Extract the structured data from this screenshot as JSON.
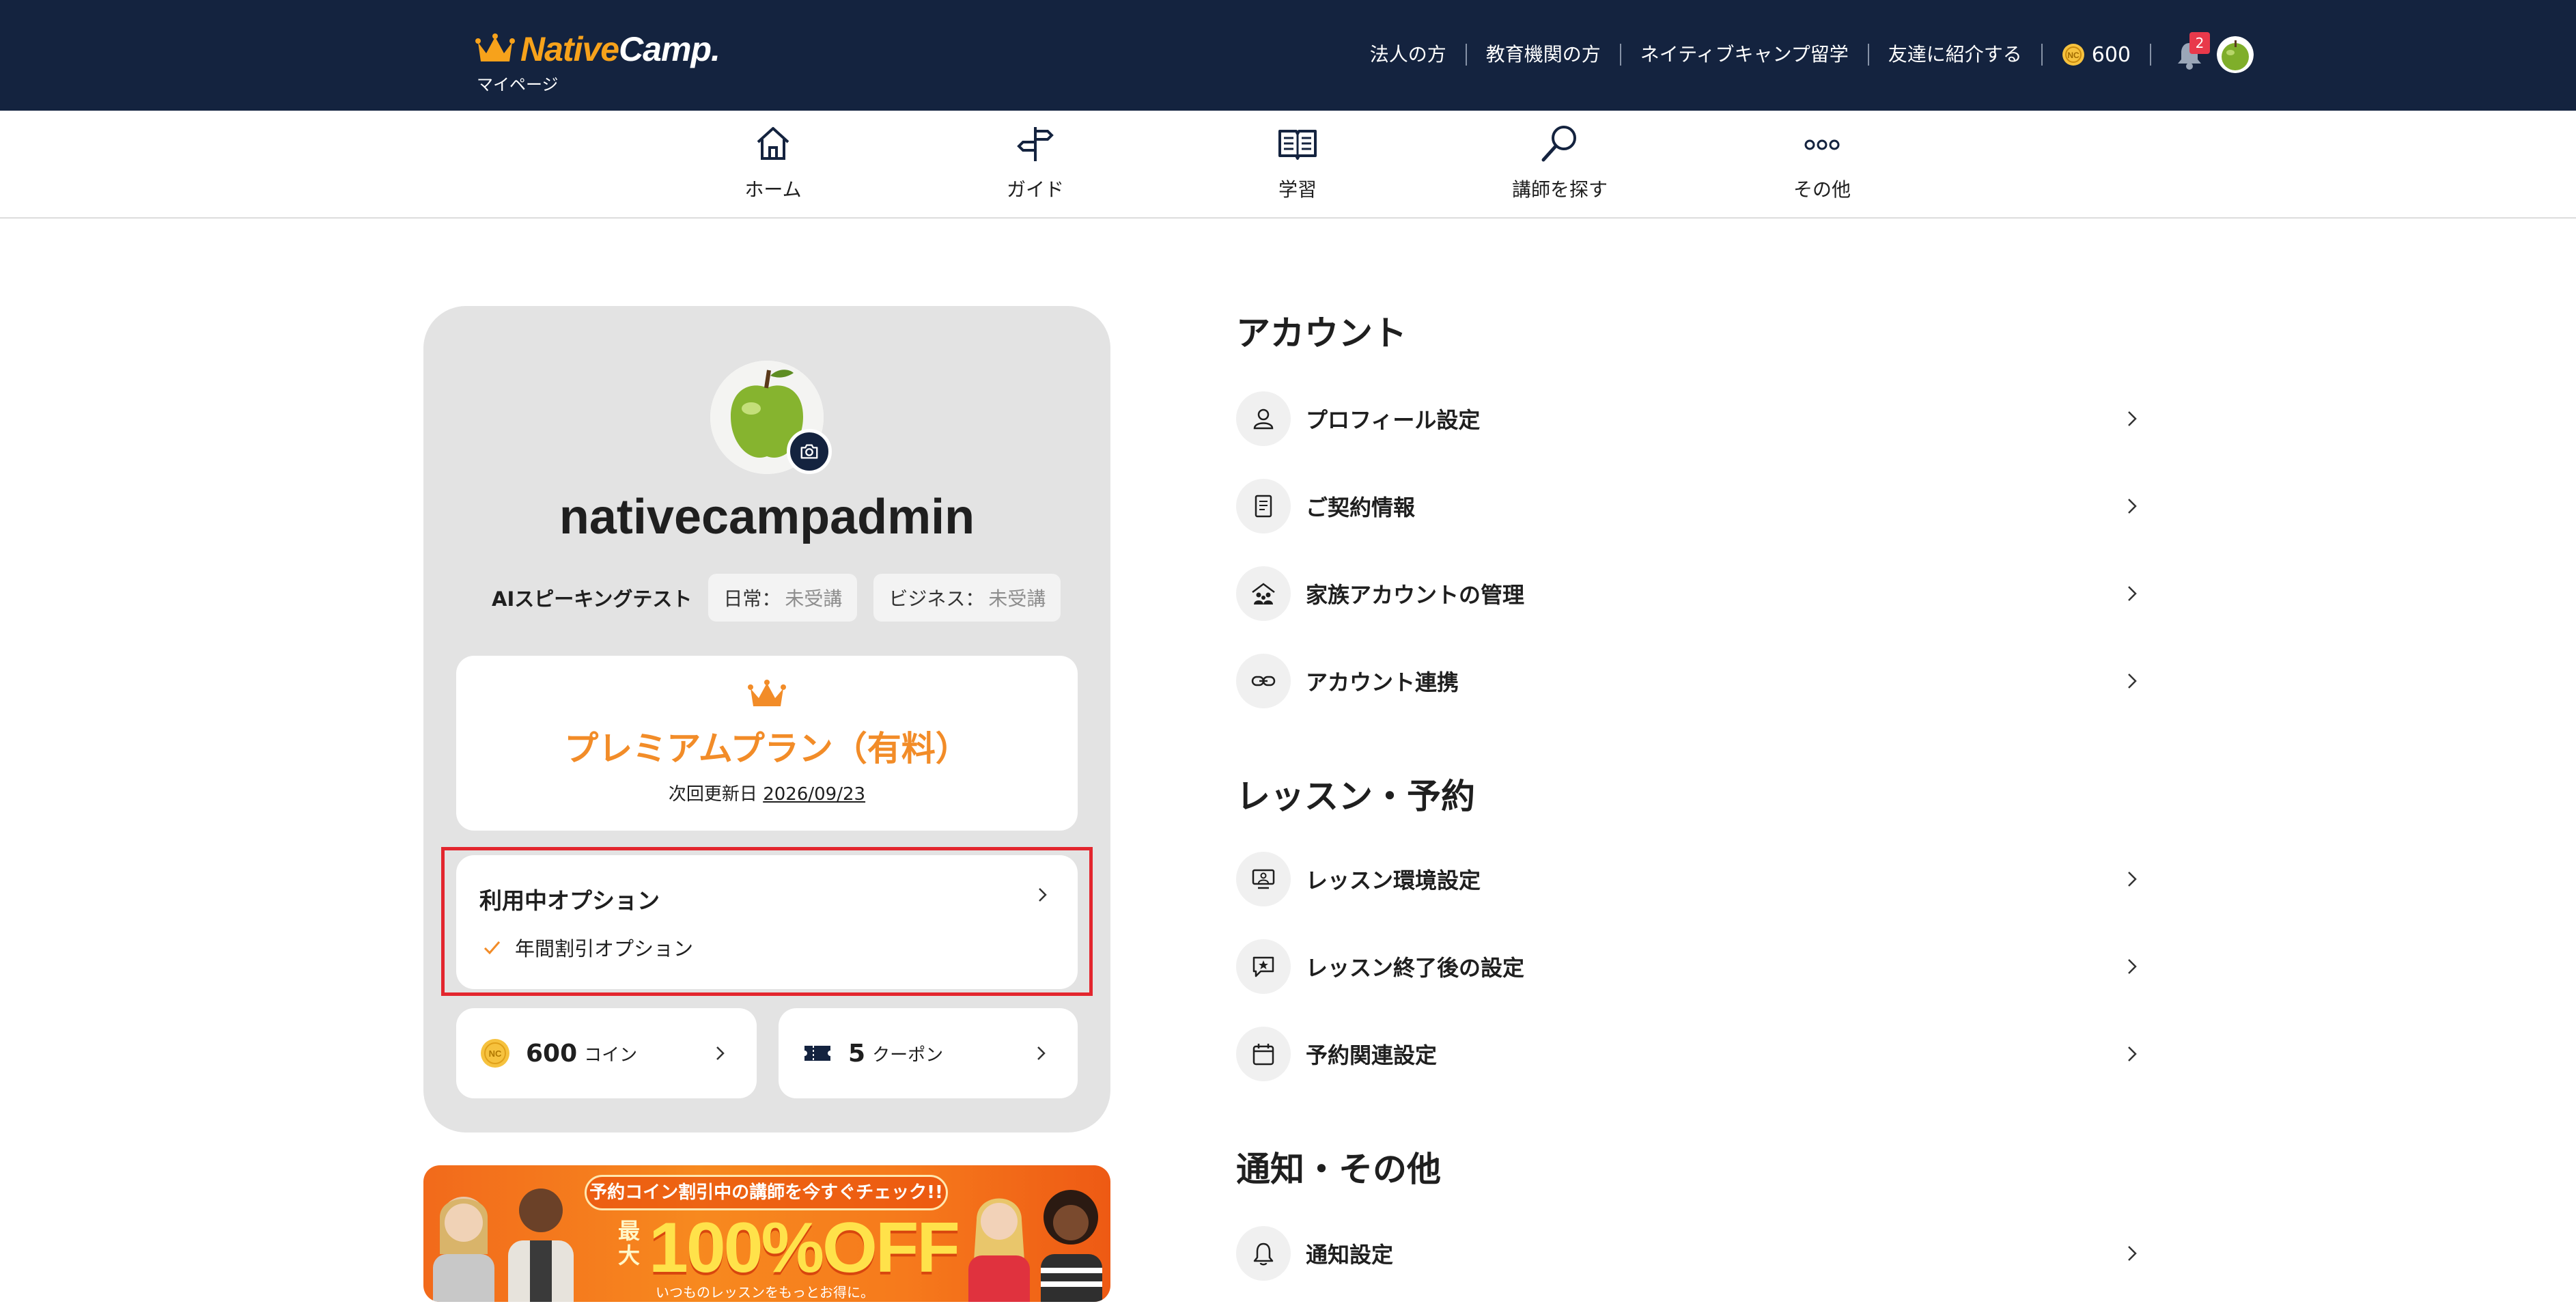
{
  "header": {
    "brand_native": "Native",
    "brand_camp": "Camp.",
    "subtitle": "マイページ",
    "links": [
      "法人の方",
      "教育機関の方",
      "ネイティブキャンプ留学",
      "友達に紹介する"
    ],
    "coins": "600",
    "notification_count": "2"
  },
  "nav": {
    "items": [
      {
        "label": "ホーム",
        "icon": "home-icon"
      },
      {
        "label": "ガイド",
        "icon": "signpost-icon"
      },
      {
        "label": "学習",
        "icon": "book-icon"
      },
      {
        "label": "講師を探す",
        "icon": "search-icon"
      },
      {
        "label": "その他",
        "icon": "more-icon"
      }
    ]
  },
  "profile": {
    "username": "nativecampadmin",
    "ai_test_label": "AIスピーキングテスト",
    "ai_daily_key": "日常：",
    "ai_daily_value": "未受講",
    "ai_business_key": "ビジネス：",
    "ai_business_value": "未受講",
    "plan_name": "プレミアムプラン（有料）",
    "renew_label": "次回更新日",
    "renew_date": "2026/09/23",
    "options_title": "利用中オプション",
    "option_item": "年間割引オプション",
    "coin_count": "600",
    "coin_unit": "コイン",
    "coupon_count": "5",
    "coupon_unit": "クーポン"
  },
  "banner": {
    "headline": "予約コイン割引中の講師を今すぐチェック!!",
    "max": "最大",
    "discount": "100%OFF",
    "sub": "いつものレッスンをもっとお得に。"
  },
  "settings": {
    "account_title": "アカウント",
    "account_items": [
      {
        "label": "プロフィール設定",
        "icon": "user-icon"
      },
      {
        "label": "ご契約情報",
        "icon": "document-icon"
      },
      {
        "label": "家族アカウントの管理",
        "icon": "family-icon"
      },
      {
        "label": "アカウント連携",
        "icon": "link-icon"
      }
    ],
    "lesson_title": "レッスン・予約",
    "lesson_items": [
      {
        "label": "レッスン環境設定",
        "icon": "monitor-icon"
      },
      {
        "label": "レッスン終了後の設定",
        "icon": "chat-star-icon"
      },
      {
        "label": "予約関連設定",
        "icon": "calendar-icon"
      }
    ],
    "notify_title": "通知・その他",
    "notify_items": [
      {
        "label": "通知設定",
        "icon": "bell-icon"
      }
    ]
  },
  "colors": {
    "header_bg": "#14233f",
    "brand_orange": "#f7a21b",
    "plan_orange": "#f28c28",
    "highlight_red": "#e3262e",
    "card_gray": "#e3e3e3"
  }
}
